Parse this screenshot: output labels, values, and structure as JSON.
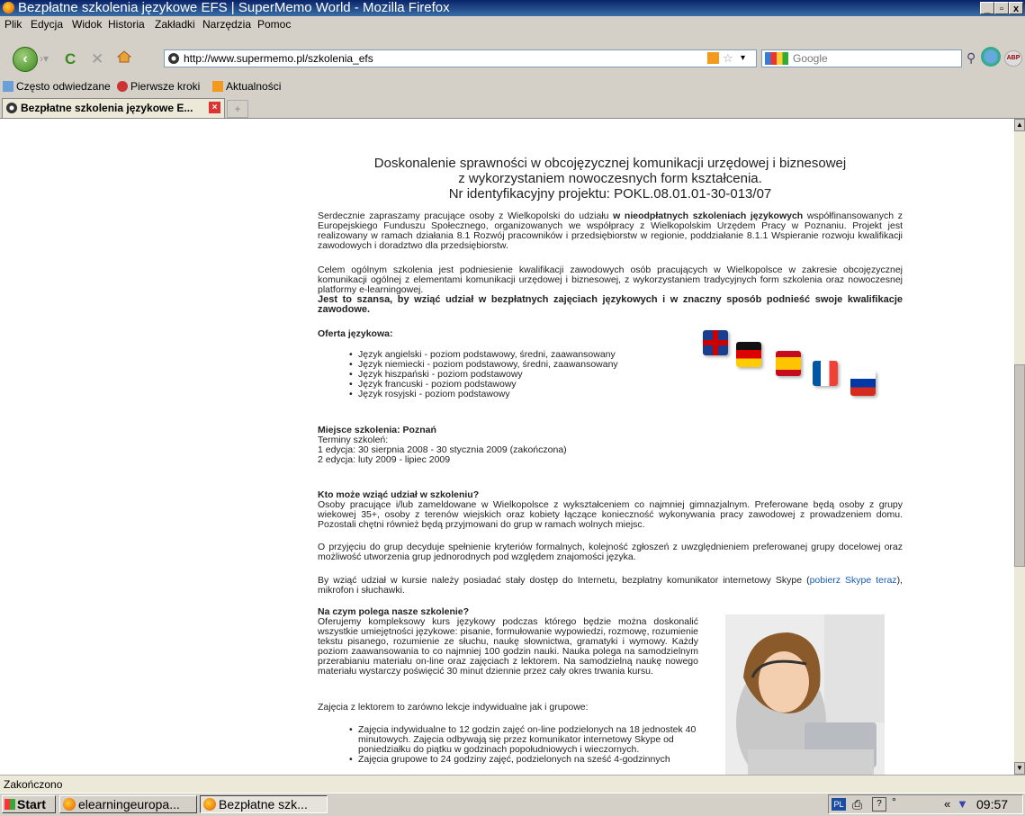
{
  "window": {
    "title": "Bezpłatne szkolenia językowe EFS | SuperMemo World - Mozilla Firefox",
    "controls": [
      "_",
      "▫",
      "x"
    ]
  },
  "menu": [
    "Plik",
    "Edycja",
    "Widok",
    "Historia",
    "Zakładki",
    "Narzędzia",
    "Pomoc"
  ],
  "toolbar": {
    "url": "http://www.supermemo.pl/szkolenia_efs",
    "search_placeholder": "Google",
    "abp": "ABP"
  },
  "bookmarks": [
    "Często odwiedzane",
    "Pierwsze kroki",
    "Aktualności"
  ],
  "tab": {
    "title": "Bezpłatne szkolenia językowe E..."
  },
  "page": {
    "header": [
      "Doskonalenie sprawności w obcojęzycznej komunikacji urzędowej i biznesowej",
      "z wykorzystaniem nowoczesnych form kształcenia.",
      "Nr identyfikacyjny projektu: POKL.08.01.01-30-013/07"
    ],
    "intro_a": "Serdecznie zapraszamy pracujące osoby z Wielkopolski do udziału ",
    "intro_bold": "w nieodpłatnych szkoleniach językowych",
    "intro_b": " współfinansowanych z Europejskiego Funduszu Społecznego, organizowanych we współpracy z Wielkopolskim Urzędem Pracy w Poznaniu. Projekt jest realizowany w ramach działania 8.1 Rozwój pracowników i przedsiębiorstw w regionie, poddziałanie 8.1.1 Wspieranie rozwoju kwalifikacji zawodowych i doradztwo dla przedsiębiorstw.",
    "goal": "Celem ogólnym szkolenia jest podniesienie kwalifikacji zawodowych osób pracujących w Wielkopolsce w zakresie obcojęzycznej komunikacji ogólnej z elementami komunikacji urzędowej i biznesowej, z wykorzystaniem tradycyjnych form szkolenia oraz nowoczesnej platformy e-learningowej.",
    "chance": "Jest to szansa, by wziąć udział w bezpłatnych zajęciach językowych i w znaczny sposób podnieść swoje kwalifikacje zawodowe.",
    "offer_title": "Oferta językowa:",
    "offer": [
      "Język angielski - poziom podstawowy, średni, zaawansowany",
      "Język niemiecki - poziom podstawowy, średni, zaawansowany",
      "Język hiszpański - poziom podstawowy",
      "Język francuski - poziom podstawowy",
      "Język rosyjski - poziom podstawowy"
    ],
    "place_title": "Miejsce szkolenia: Poznań",
    "place_lines": [
      "Terminy szkoleń:",
      "1 edycja: 30 sierpnia 2008 - 30 stycznia 2009 (zakończona)",
      "2 edycja: luty 2009 - lipiec 2009"
    ],
    "who_title": "Kto może wziąć udział w szkoleniu?",
    "who": "Osoby pracujące i/lub zameldowane w Wielkopolsce z wykształceniem co najmniej gimnazjalnym. Preferowane będą osoby z grupy wiekowej 35+, osoby z terenów wiejskich oraz kobiety łączące konieczność wykonywania pracy zawodowej z prowadzeniem domu. Pozostali chętni również będą przyjmowani do grup w ramach wolnych miejsc.",
    "groups": "O przyjęciu do grup decyduje spełnienie kryteriów formalnych, kolejność zgłoszeń z uwzględnieniem preferowanej grupy docelowej oraz możliwość utworzenia grup jednorodnych pod względem znajomości języka.",
    "req_a": "By wziąć udział w kursie należy posiadać stały dostęp do Internetu, bezpłatny komunikator internetowy Skype (",
    "req_link": "pobierz Skype teraz",
    "req_b": "), mikrofon i słuchawki.",
    "what_title": "Na czym polega nasze szkolenie?",
    "what": "Oferujemy kompleksowy kurs językowy podczas którego będzie można doskonalić wszystkie umiejętności językowe: pisanie, formułowanie wypowiedzi, rozmowę, rozumienie tekstu pisanego, rozumienie ze słuchu, naukę słownictwa, gramatyki i wymowy. Każdy poziom zaawansowania to co najmniej 100 godzin nauki. Nauka polega na samodzielnym przerabianiu materiału on-line oraz zajęciach z lektorem. Na samodzielną naukę nowego materiału wystarczy poświęcić 30 minut dziennie przez cały okres trwania kursu.",
    "lector": "Zajęcia z lektorem to zarówno lekcje indywidualne jak i grupowe:",
    "lector_items": [
      "Zajęcia indywidualne to 12 godzin zajęć on-line podzielonych na 18 jednostek 40 minutowych. Zajęcia odbywają się przez komunikator internetowy Skype od poniedziałku do piątku w godzinach popołudniowych i wieczornych.",
      "Zajęcia grupowe to 24 godziny zajęć, podzielonych na sześć 4-godzinnych"
    ]
  },
  "status": "Zakończono",
  "taskbar": {
    "start": "Start",
    "items": [
      "elearningeuropa...",
      "Bezpłatne szk..."
    ],
    "clock": "09:57",
    "lang": "PL"
  }
}
